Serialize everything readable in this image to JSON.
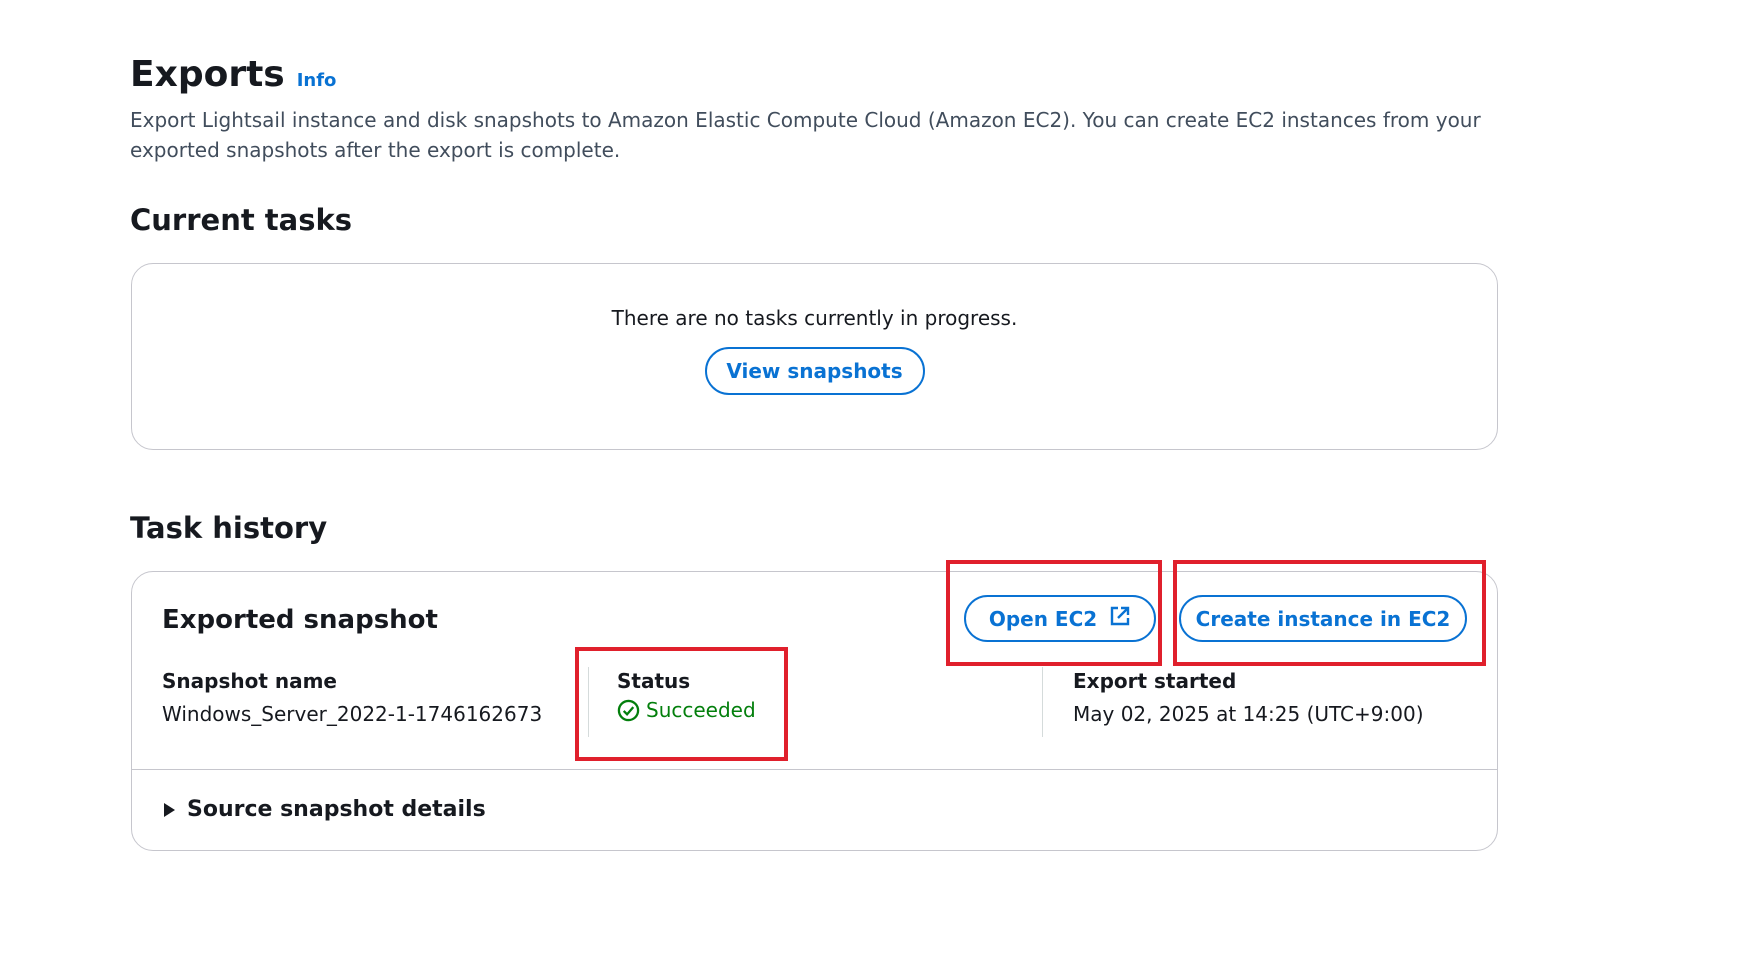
{
  "header": {
    "title": "Exports",
    "info_label": "Info",
    "description": "Export Lightsail instance and disk snapshots to Amazon Elastic Compute Cloud (Amazon EC2). You can create EC2 instances from your exported snapshots after the export is complete."
  },
  "current_tasks": {
    "title": "Current tasks",
    "empty_message": "There are no tasks currently in progress.",
    "view_snapshots_label": "View snapshots"
  },
  "task_history": {
    "title": "Task history",
    "card": {
      "heading": "Exported snapshot",
      "open_ec2_label": "Open EC2",
      "open_ec2_icon": "external-link-icon",
      "create_instance_label": "Create instance in EC2",
      "snapshot_name_label": "Snapshot name",
      "snapshot_name_value": "Windows_Server_2022-1-1746162673",
      "status_label": "Status",
      "status_value": "Succeeded",
      "status_icon": "check-circle-icon",
      "export_started_label": "Export started",
      "export_started_value": "May 02, 2025 at 14:25 (UTC+9:00)",
      "source_details_label": "Source snapshot details"
    }
  },
  "colors": {
    "link": "#0972d3",
    "success": "#037f0c",
    "highlight": "#e0202c"
  }
}
